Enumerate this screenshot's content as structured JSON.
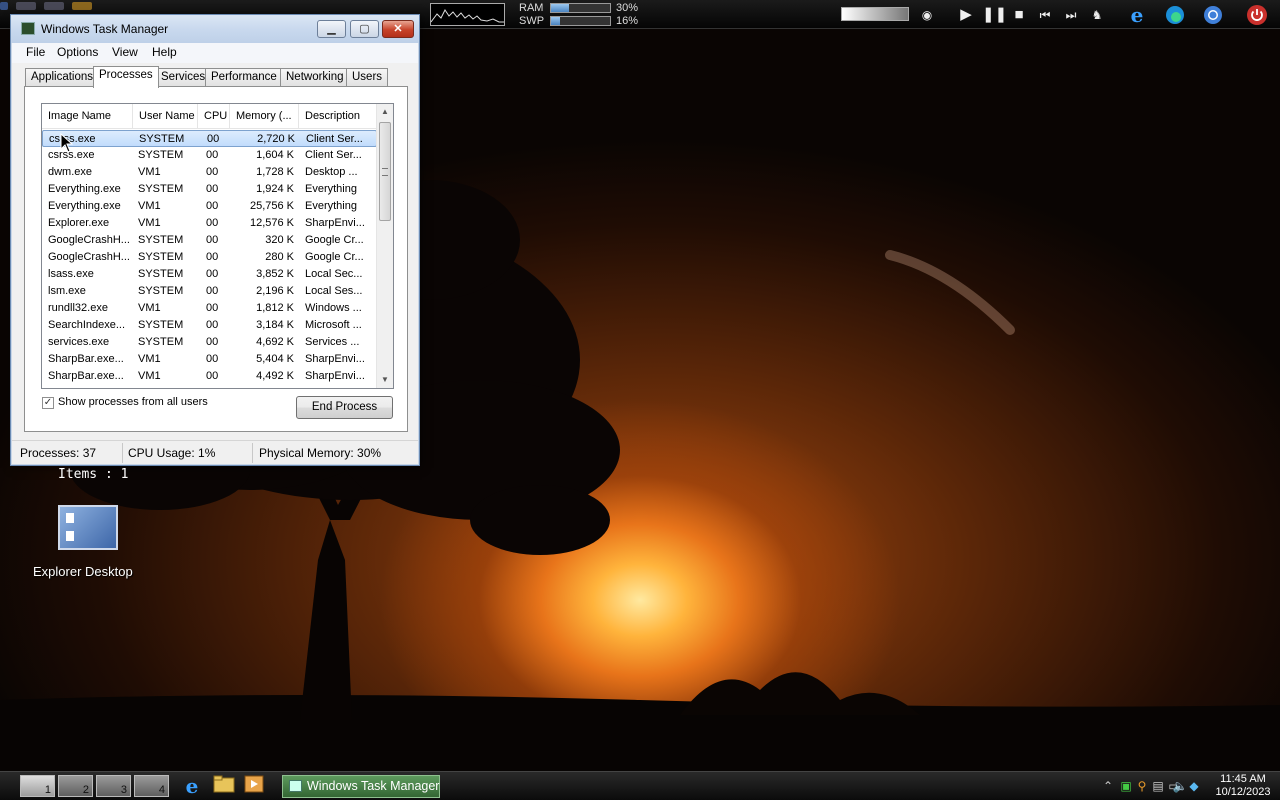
{
  "top_bar": {
    "ram_label": "RAM",
    "ram_pct": "30%",
    "ram_fraction": 0.3,
    "swap_label": "SWP",
    "swap_pct": "16%",
    "swap_fraction": 0.16,
    "media_icons": [
      "play-icon",
      "pause-icon",
      "stop-icon",
      "previous-icon",
      "next-icon"
    ],
    "browser_icons": [
      "internet-explorer-icon",
      "edge-icon",
      "chrome-icon"
    ],
    "power_icon": "power-icon"
  },
  "window": {
    "title": "Windows Task Manager",
    "menu": [
      "File",
      "Options",
      "View",
      "Help"
    ],
    "tabs": [
      {
        "label": "Applications",
        "active": false
      },
      {
        "label": "Processes",
        "active": true
      },
      {
        "label": "Services",
        "active": false
      },
      {
        "label": "Performance",
        "active": false
      },
      {
        "label": "Networking",
        "active": false
      },
      {
        "label": "Users",
        "active": false
      }
    ],
    "columns": [
      "Image Name",
      "User Name",
      "CPU",
      "Memory (...",
      "Description"
    ],
    "processes": [
      {
        "name": "csrss.exe",
        "user": "SYSTEM",
        "cpu": "00",
        "memory": "2,720 K",
        "description": "Client Ser...",
        "selected": true
      },
      {
        "name": "csrss.exe",
        "user": "SYSTEM",
        "cpu": "00",
        "memory": "1,604 K",
        "description": "Client Ser..."
      },
      {
        "name": "dwm.exe",
        "user": "VM1",
        "cpu": "00",
        "memory": "1,728 K",
        "description": "Desktop ..."
      },
      {
        "name": "Everything.exe",
        "user": "SYSTEM",
        "cpu": "00",
        "memory": "1,924 K",
        "description": "Everything"
      },
      {
        "name": "Everything.exe",
        "user": "VM1",
        "cpu": "00",
        "memory": "25,756 K",
        "description": "Everything"
      },
      {
        "name": "Explorer.exe",
        "user": "VM1",
        "cpu": "00",
        "memory": "12,576 K",
        "description": "SharpEnvi..."
      },
      {
        "name": "GoogleCrashH...",
        "user": "SYSTEM",
        "cpu": "00",
        "memory": "320 K",
        "description": "Google Cr..."
      },
      {
        "name": "GoogleCrashH...",
        "user": "SYSTEM",
        "cpu": "00",
        "memory": "280 K",
        "description": "Google Cr..."
      },
      {
        "name": "lsass.exe",
        "user": "SYSTEM",
        "cpu": "00",
        "memory": "3,852 K",
        "description": "Local Sec..."
      },
      {
        "name": "lsm.exe",
        "user": "SYSTEM",
        "cpu": "00",
        "memory": "2,196 K",
        "description": "Local Ses..."
      },
      {
        "name": "rundll32.exe",
        "user": "VM1",
        "cpu": "00",
        "memory": "1,812 K",
        "description": "Windows ..."
      },
      {
        "name": "SearchIndexe...",
        "user": "SYSTEM",
        "cpu": "00",
        "memory": "3,184 K",
        "description": "Microsoft ..."
      },
      {
        "name": "services.exe",
        "user": "SYSTEM",
        "cpu": "00",
        "memory": "4,692 K",
        "description": "Services ..."
      },
      {
        "name": "SharpBar.exe...",
        "user": "VM1",
        "cpu": "00",
        "memory": "5,404 K",
        "description": "SharpEnvi..."
      },
      {
        "name": "SharpBar.exe...",
        "user": "VM1",
        "cpu": "00",
        "memory": "4,492 K",
        "description": "SharpEnvi..."
      }
    ],
    "show_all_users_label": "Show processes from all users",
    "show_all_users_checked": true,
    "end_process_label": "End Process",
    "status": {
      "processes": "Processes: 37",
      "cpu": "CPU Usage: 1%",
      "memory": "Physical Memory: 30%"
    }
  },
  "desktop": {
    "items_label": "Items : 1",
    "explorer_label": "Explorer Desktop"
  },
  "taskbar": {
    "desktops": [
      "1",
      "2",
      "3",
      "4"
    ],
    "active_desktop": 0,
    "task_label": "Windows Task Manager",
    "clock_time": "11:45 AM",
    "clock_date": "10/12/2023"
  }
}
